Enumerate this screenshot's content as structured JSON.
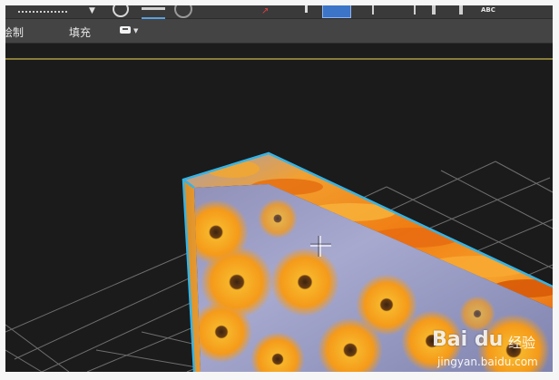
{
  "ribbon": {
    "tab_draw": "绘制",
    "tab_fill": "填充"
  },
  "toolbar": {
    "text_tool_label": "ABC"
  },
  "watermark": {
    "brand": "Bai du",
    "text": "经验",
    "url": "jingyan.baidu.com"
  },
  "colors": {
    "toolbar_bg": "#3a3a3a",
    "ribbon_bg": "#444444",
    "viewport_bg": "#1b1b1b",
    "selection_highlight": "#35b4e6",
    "viewport_border": "#8a7d3a",
    "grid": "#6e6e6e"
  },
  "icons": [
    "dotted-line-icon",
    "arrow-icon",
    "circle-icon",
    "lines-icon",
    "red-arrow-icon",
    "pin-icon",
    "select-rect-icon",
    "grid-icon",
    "text-icon",
    "cursor-crosshair-icon",
    "dropdown-box-icon"
  ]
}
